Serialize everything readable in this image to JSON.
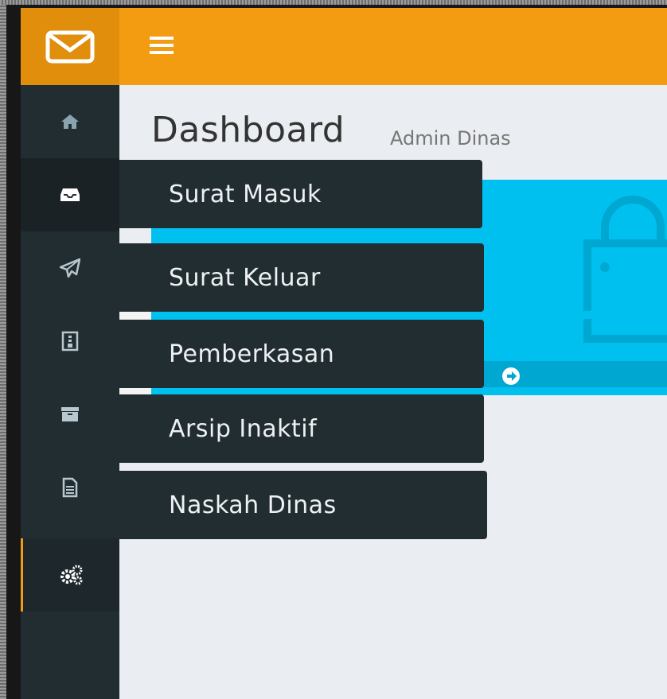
{
  "header": {
    "logo_icon": "envelope-icon",
    "menu_icon": "hamburger-menu-icon",
    "accent_color": "#f39c12"
  },
  "sidebar": {
    "items": [
      {
        "icon": "home-icon"
      },
      {
        "icon": "inbox-icon"
      },
      {
        "icon": "paper-plane-icon"
      },
      {
        "icon": "file-archive-icon"
      },
      {
        "icon": "archive-box-icon"
      },
      {
        "icon": "document-icon"
      },
      {
        "icon": "gears-icon"
      }
    ]
  },
  "page": {
    "title": "Dashboard",
    "subtitle": "Admin Dinas"
  },
  "flyout_menu": {
    "items": [
      {
        "label": "Surat Masuk"
      },
      {
        "label": "Surat Keluar"
      },
      {
        "label": "Pemberkasan"
      },
      {
        "label": "Arsip Inaktif"
      },
      {
        "label": "Naskah Dinas"
      }
    ]
  },
  "info_box": {
    "color": "#00c0ef",
    "footer_icon": "arrow-circle-right-icon",
    "bag_icon": "shopping-bag-icon"
  }
}
